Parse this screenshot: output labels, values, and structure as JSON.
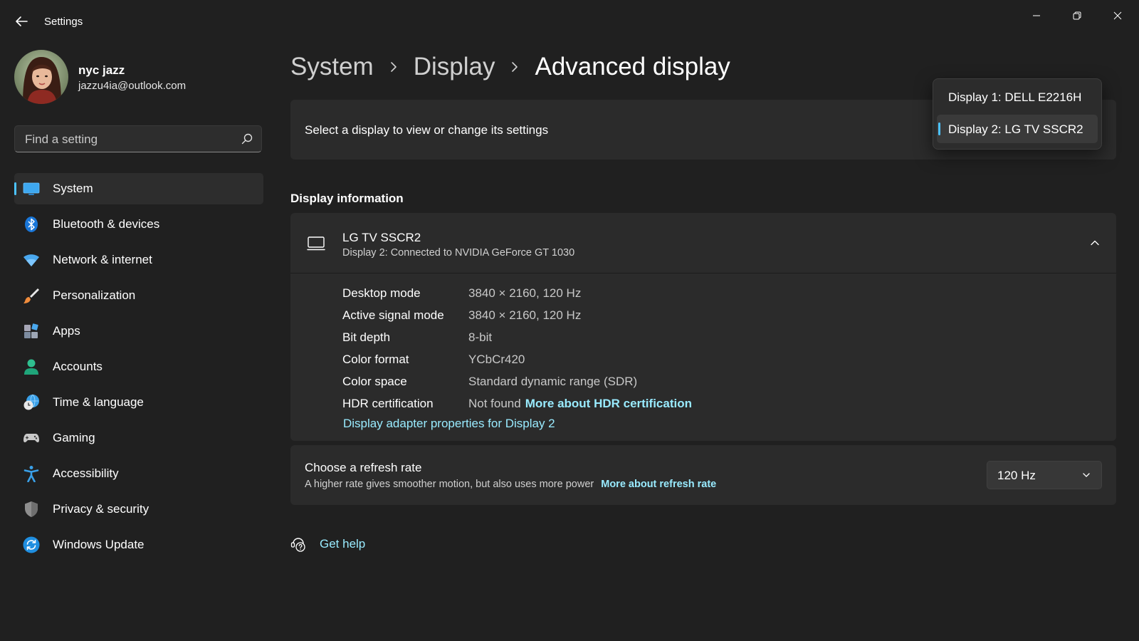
{
  "window": {
    "title": "Settings"
  },
  "user": {
    "name": "nyc jazz",
    "email": "jazzu4ia@outlook.com"
  },
  "search": {
    "placeholder": "Find a setting"
  },
  "sidebar": {
    "items": [
      {
        "label": "System",
        "icon": "system-icon",
        "active": true
      },
      {
        "label": "Bluetooth & devices",
        "icon": "bluetooth-icon"
      },
      {
        "label": "Network & internet",
        "icon": "wifi-icon"
      },
      {
        "label": "Personalization",
        "icon": "brush-icon"
      },
      {
        "label": "Apps",
        "icon": "apps-icon"
      },
      {
        "label": "Accounts",
        "icon": "person-icon"
      },
      {
        "label": "Time & language",
        "icon": "globe-clock-icon"
      },
      {
        "label": "Gaming",
        "icon": "gamepad-icon"
      },
      {
        "label": "Accessibility",
        "icon": "accessibility-icon"
      },
      {
        "label": "Privacy & security",
        "icon": "shield-icon"
      },
      {
        "label": "Windows Update",
        "icon": "sync-icon"
      }
    ]
  },
  "breadcrumb": {
    "items": [
      "System",
      "Display",
      "Advanced display"
    ]
  },
  "select_display": {
    "label": "Select a display to view or change its settings",
    "options": [
      "Display 1: DELL E2216H",
      "Display 2: LG TV SSCR2"
    ],
    "selected": "Display 2: LG TV SSCR2"
  },
  "display_info": {
    "section_title": "Display information",
    "name": "LG TV SSCR2",
    "subtitle": "Display 2: Connected to NVIDIA GeForce GT 1030",
    "rows": [
      {
        "label": "Desktop mode",
        "value": "3840 × 2160, 120 Hz"
      },
      {
        "label": "Active signal mode",
        "value": "3840 × 2160, 120 Hz"
      },
      {
        "label": "Bit depth",
        "value": "8-bit"
      },
      {
        "label": "Color format",
        "value": "YCbCr420"
      },
      {
        "label": "Color space",
        "value": "Standard dynamic range (SDR)"
      },
      {
        "label": "HDR certification",
        "value": "Not found",
        "link": "More about HDR certification"
      }
    ],
    "adapter_link": "Display adapter properties for Display 2"
  },
  "refresh_rate": {
    "title": "Choose a refresh rate",
    "description": "A higher rate gives smoother motion, but also uses more power",
    "link": "More about refresh rate",
    "value": "120 Hz"
  },
  "help": {
    "label": "Get help"
  },
  "colors": {
    "background": "#202020",
    "card": "#2b2b2b",
    "accent": "#4cc2ff",
    "link": "#99ebff"
  }
}
